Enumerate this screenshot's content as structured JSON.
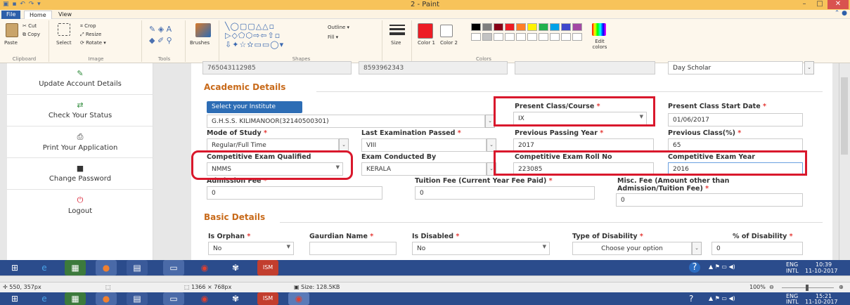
{
  "window": {
    "title": "2 - Paint",
    "minimize": "–",
    "maximize": "□",
    "close": "✕"
  },
  "ribbon": {
    "tabs": [
      "File",
      "Home",
      "View"
    ],
    "clipboard": {
      "paste": "Paste",
      "cut": "Cut",
      "copy": "Copy",
      "label": "Clipboard"
    },
    "image": {
      "crop": "Crop",
      "resize": "Resize",
      "select": "Select",
      "rotate": "Rotate ▾",
      "label": "Image"
    },
    "tools": {
      "label": "Tools"
    },
    "brushes": "Brushes",
    "shapes": {
      "outline": "Outline ▾",
      "fill": "Fill ▾",
      "label": "Shapes"
    },
    "size": "Size",
    "color1": "Color\n1",
    "color2": "Color\n2",
    "colors_label": "Colors",
    "edit_colors": "Edit colors",
    "palette_row1": [
      "#000000",
      "#7f7f7f",
      "#880015",
      "#ed1c24",
      "#ff7f27",
      "#fff200",
      "#22b14c",
      "#00a2e8",
      "#3f48cc",
      "#a349a4"
    ],
    "palette_row2": [
      "#ffffff",
      "#c3c3c3",
      "#ffffff",
      "#ffffff",
      "#ffffff",
      "#ffffff",
      "#ffffff",
      "#ffffff",
      "#ffffff",
      "#ffffff"
    ],
    "color1_value": "#ed1c24",
    "color2_value": "#ffffff"
  },
  "sidebar": {
    "items": [
      {
        "label": "Update Account Details",
        "icon": "edit-icon"
      },
      {
        "label": "Check Your Status",
        "icon": "exchange-icon"
      },
      {
        "label": "Print Your Application",
        "icon": "print-icon"
      },
      {
        "label": "Change Password",
        "icon": "lock-icon"
      },
      {
        "label": "Logout",
        "icon": "power-icon"
      }
    ]
  },
  "form": {
    "top_row": {
      "f1": "765043112985",
      "f2": "8593962343",
      "f3": "",
      "f4": "Day Scholar"
    },
    "academic_title": "Academic Details",
    "select_institute": "Select your Institute",
    "institute": "G.H.S.S. KILIMANOOR(32140500301)",
    "present_class_label": "Present Class/Course",
    "present_class": "IX",
    "start_date_label": "Present Class Start Date",
    "start_date": "01/06/2017",
    "mode_label": "Mode of Study",
    "mode": "Regular/Full Time",
    "last_exam_label": "Last Examination Passed",
    "last_exam": "VIII",
    "prev_year_label": "Previous Passing Year",
    "prev_year": "2017",
    "prev_class_label": "Previous Class(%)",
    "prev_class": "65",
    "comp_exam_label": "Competitive Exam Qualified",
    "comp_exam": "NMMS",
    "exam_by_label": "Exam Conducted By",
    "exam_by": "KERALA",
    "roll_label": "Competitive Exam Roll No",
    "roll": "223085",
    "comp_year_label": "Competitive Exam Year",
    "comp_year": "2016",
    "admission_label": "Admission Fee",
    "admission": "0",
    "tuition_label": "Tuition Fee (Current Year Fee Paid)",
    "tuition": "0",
    "misc_label_1": "Misc. Fee (Amount other than",
    "misc_label_2": "Admission/Tuition Fee)",
    "misc": "0",
    "basic_title": "Basic Details",
    "orphan_label": "Is Orphan",
    "orphan": "No",
    "guardian_label": "Gaurdian Name",
    "disabled_label": "Is Disabled",
    "disabled": "No",
    "disability_type_label": "Type of Disability",
    "disability_type": "Choose your option",
    "disability_pct_label": "% of Disability",
    "disability_pct": "0",
    "required_mark": "*"
  },
  "taskbar": {
    "lang": "ENG",
    "locale": "INTL",
    "time": "10:39",
    "date": "11-10-2017",
    "time2": "15:21",
    "date2": "11-10-2017"
  },
  "statusbar": {
    "coords": "550, 357px",
    "dimensions": "1366 × 768px",
    "size": "Size: 128.5KB",
    "zoom": "100%"
  }
}
